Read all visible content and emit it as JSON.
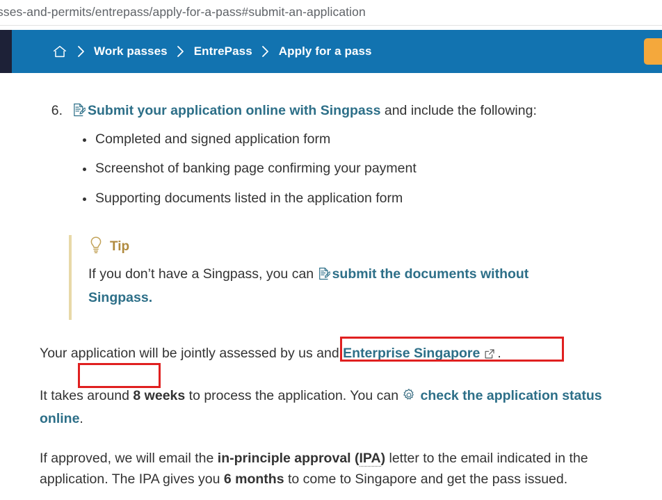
{
  "browser": {
    "url_text": "sses-and-permits/entrepass/apply-for-a-pass#submit-an-application"
  },
  "breadcrumb": {
    "home_icon": "home-icon",
    "separator": "chevron-right-icon",
    "items": [
      {
        "label": "Work passes"
      },
      {
        "label": "EntrePass"
      },
      {
        "label": "Apply for a pass"
      }
    ],
    "cta_button_label": ""
  },
  "main": {
    "step": {
      "number": "6.",
      "icon": "form-document-icon",
      "link_text": "Submit your application online with Singpass",
      "trailing_text": " and include the following:"
    },
    "bullets": [
      "Completed and signed application form",
      "Screenshot of banking page confirming your payment",
      "Supporting documents listed in the application form"
    ],
    "tip": {
      "icon": "lightbulb-icon",
      "title": "Tip",
      "lead_text": "If you don’t have a Singpass, you can ",
      "inline_icon": "form-document-icon",
      "link_text": "submit the documents without Singpass."
    },
    "paragraphs": {
      "assessment": {
        "lead": "Your application will be jointly assessed by us and ",
        "link_text": "Enterprise Singapore",
        "external_icon": "external-link-icon",
        "tail": "."
      },
      "processing": {
        "lead": "It takes around ",
        "bold_duration": "8 weeks",
        "mid": " to process the application. You can ",
        "icon": "gear-icon",
        "link_text": "check the application status online",
        "tail": "."
      },
      "approval": {
        "lead": "If approved, we will email the ",
        "bold_term": "in-principle approval (",
        "abbr": "IPA",
        "bold_term_close": ")",
        "mid": " letter to the email indicated in the application. The IPA gives you ",
        "bold_validity": "6 months",
        "tail": " to come to Singapore and get the pass issued."
      }
    }
  },
  "annotations": {
    "color": "#e02020",
    "boxes": [
      {
        "name": "highlight-submit-documents-link"
      },
      {
        "name": "highlight-singpass-link"
      }
    ]
  },
  "colors": {
    "nav_blue": "#1273b0",
    "nav_dark": "#1d2137",
    "link_teal": "#2d6f88",
    "tip_amber": "#b08a3e",
    "cta_orange": "#f4a83c"
  }
}
